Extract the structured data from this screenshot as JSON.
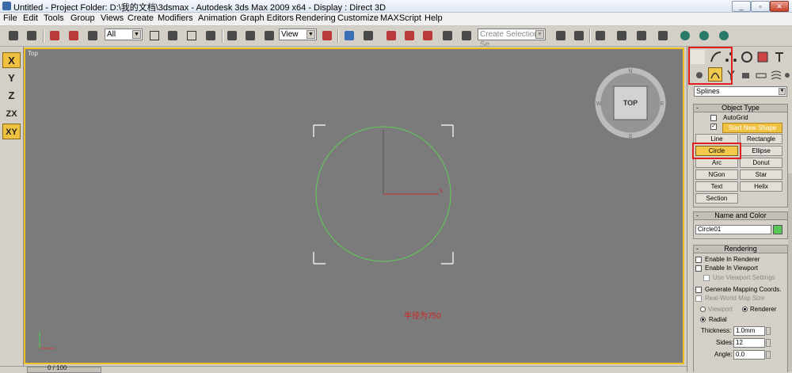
{
  "window": {
    "title": "Untitled    - Project Folder: D:\\我的文档\\3dsmax    - Autodesk 3ds Max  2009 x64      - Display : Direct 3D"
  },
  "menu": [
    "File",
    "Edit",
    "Tools",
    "Group",
    "Views",
    "Create",
    "Modifiers",
    "Animation",
    "Graph Editors",
    "Rendering",
    "Customize",
    "MAXScript",
    "Help"
  ],
  "toolbar": {
    "filter_value": "All",
    "refcoord_value": "View",
    "selection_set_placeholder": "Create Selection Se"
  },
  "axis_buttons": [
    "X",
    "Y",
    "Z",
    "ZX",
    "XY"
  ],
  "viewport": {
    "label": "Top",
    "viewcube_label": "TOP",
    "compass_letters": [
      "N",
      "S",
      "W",
      "E"
    ],
    "annotation": "半径为750",
    "pivot_axis_label": "x"
  },
  "timeline": {
    "frame_text": "0 / 100"
  },
  "command_panel": {
    "category": "Splines",
    "object_type": {
      "title": "Object Type",
      "autogrid": "AutoGrid",
      "start_new_shape": "Start New Shape",
      "buttons": [
        "Line",
        "Rectangle",
        "Circle",
        "Ellipse",
        "Arc",
        "Donut",
        "NGon",
        "Star",
        "Text",
        "Helix",
        "Section"
      ],
      "active": "Circle"
    },
    "name_color": {
      "title": "Name and Color",
      "name_value": "Circle01",
      "color": "#59c85a"
    },
    "rendering": {
      "title": "Rendering",
      "enable_renderer": "Enable In Renderer",
      "enable_viewport": "Enable In Viewport",
      "use_viewport_settings": "Use Viewport Settings",
      "generate_mapping": "Generate Mapping Coords.",
      "real_world": "Real-World Map Size",
      "viewport_radio": "Viewport",
      "renderer_radio": "Renderer",
      "radial": "Radial",
      "thickness_label": "Thickness:",
      "thickness_value": "1.0mm",
      "sides_label": "Sides:",
      "sides_value": "12",
      "angle_label": "Angle:",
      "angle_value": "0.0"
    }
  }
}
